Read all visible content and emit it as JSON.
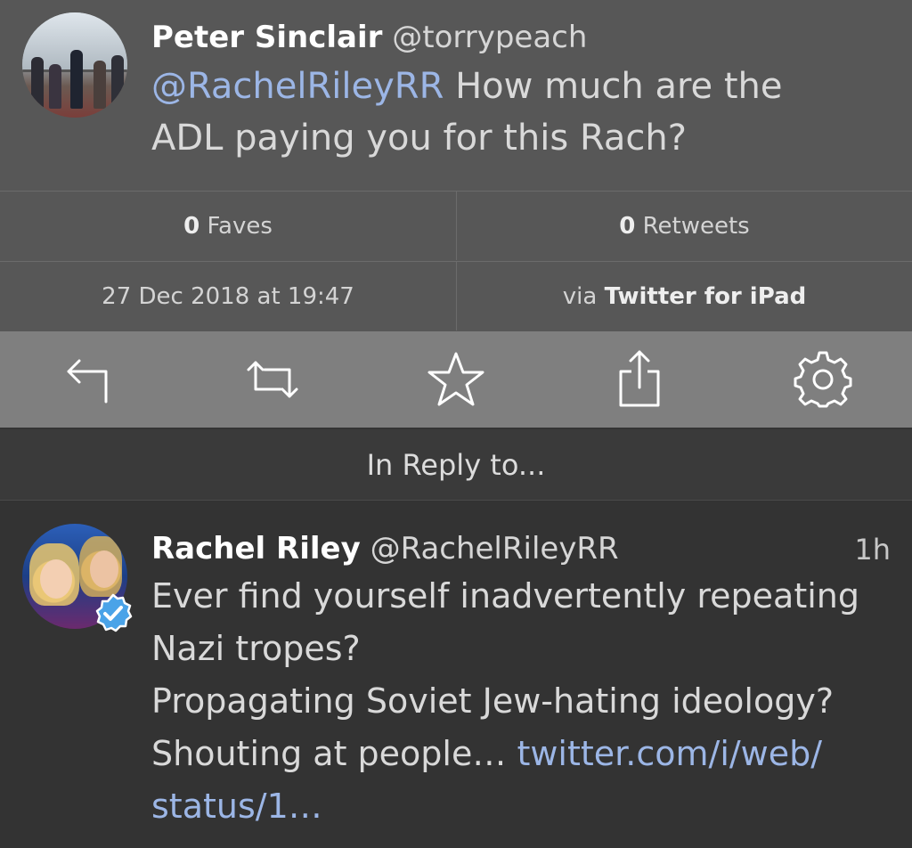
{
  "main_tweet": {
    "author_name": "Peter Sinclair",
    "author_handle": "@torrypeach",
    "mention": "@RachelRileyRR",
    "text_line1_rest": " How much are the",
    "text_line2": "ADL paying you for this Rach?"
  },
  "stats": {
    "faves_count": "0",
    "faves_label": " Faves",
    "retweets_count": "0",
    "retweets_label": " Retweets",
    "date": "27 Dec 2018 at 19:47",
    "via_prefix": "via ",
    "via_client": "Twitter for iPad"
  },
  "toolbar": {
    "icons": [
      "reply-icon",
      "retweet-icon",
      "star-icon",
      "share-icon",
      "gear-icon"
    ]
  },
  "reply_header": {
    "label": "In Reply to..."
  },
  "reply_tweet": {
    "author_name": "Rachel Riley",
    "author_handle": "@RachelRileyRR",
    "time": "1h",
    "line1": "Ever find yourself inadvertently repeating",
    "line2": "Nazi tropes?",
    "line3": "Propagating Soviet Jew-hating ideology?",
    "line4_text": "Shouting at people… ",
    "line4_link": "twitter.com/i/web/",
    "line5_link": "status/1…"
  },
  "colors": {
    "mention": "#9cb6e6",
    "top_bg": "#575757",
    "toolbar_bg": "#7f7f7f",
    "bottom_bg": "#333333",
    "verified": "#4aa3e8"
  }
}
